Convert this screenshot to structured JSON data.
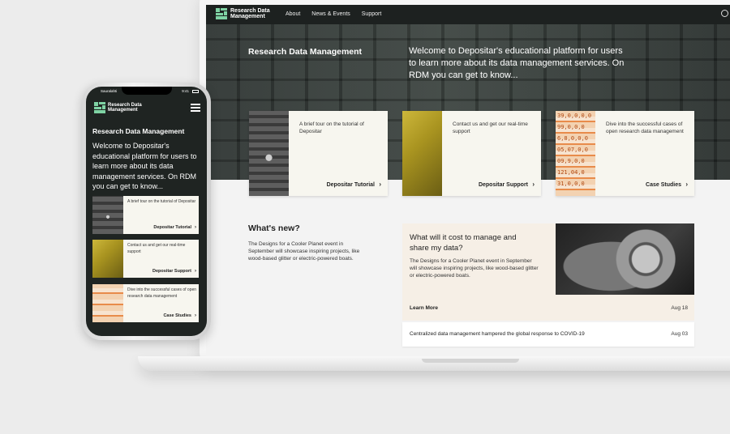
{
  "site": {
    "logo_line1": "Research Data",
    "logo_line2": "Management",
    "nav": [
      "About",
      "News & Events",
      "Support"
    ]
  },
  "hero": {
    "title": "Research Data Management",
    "intro": "Welcome to Depositar's educational platform for users to learn more about its data management services. On RDM you can get to know..."
  },
  "cards": [
    {
      "desc": "A brief tour on the tutorial of Depositar",
      "link": "Depositar Tutorial"
    },
    {
      "desc": "Contact us and get our real-time support",
      "link": "Depositar Support"
    },
    {
      "desc": "Dive into the successful cases of open research data management",
      "link": "Case Studies"
    }
  ],
  "card3_thumb_digits": [
    "39,0,0,0,0",
    "99,0,0,0",
    "6,8,0,0,0",
    "05,07,0,0",
    "09,9,0,0",
    "121,04,0",
    "31,0,0,0"
  ],
  "news": {
    "heading": "What's new?",
    "text": "The Designs for a Cooler Planet event in September will showcase inspiring projects, like wood-based glitter or electric-powered boats.",
    "feature": {
      "title": "What will it cost to manage and share my data?",
      "text": "The Designs for a Cooler Planet event in September will showcase inspiring projects, like wood-based glitter or electric-powered boats.",
      "more": "Learn More",
      "date": "Aug 18"
    },
    "item": {
      "title": "Centralized data management hampered the global response to COVID-19",
      "date": "Aug 03"
    }
  },
  "phone": {
    "carrier": "Sauralahti",
    "time": "9:41"
  },
  "colors": {
    "hero_bg": "#2e3432",
    "card_bg": "#f7f6ef",
    "feature_bg": "#f6efe6",
    "logo_green": "#7fd3a4"
  }
}
